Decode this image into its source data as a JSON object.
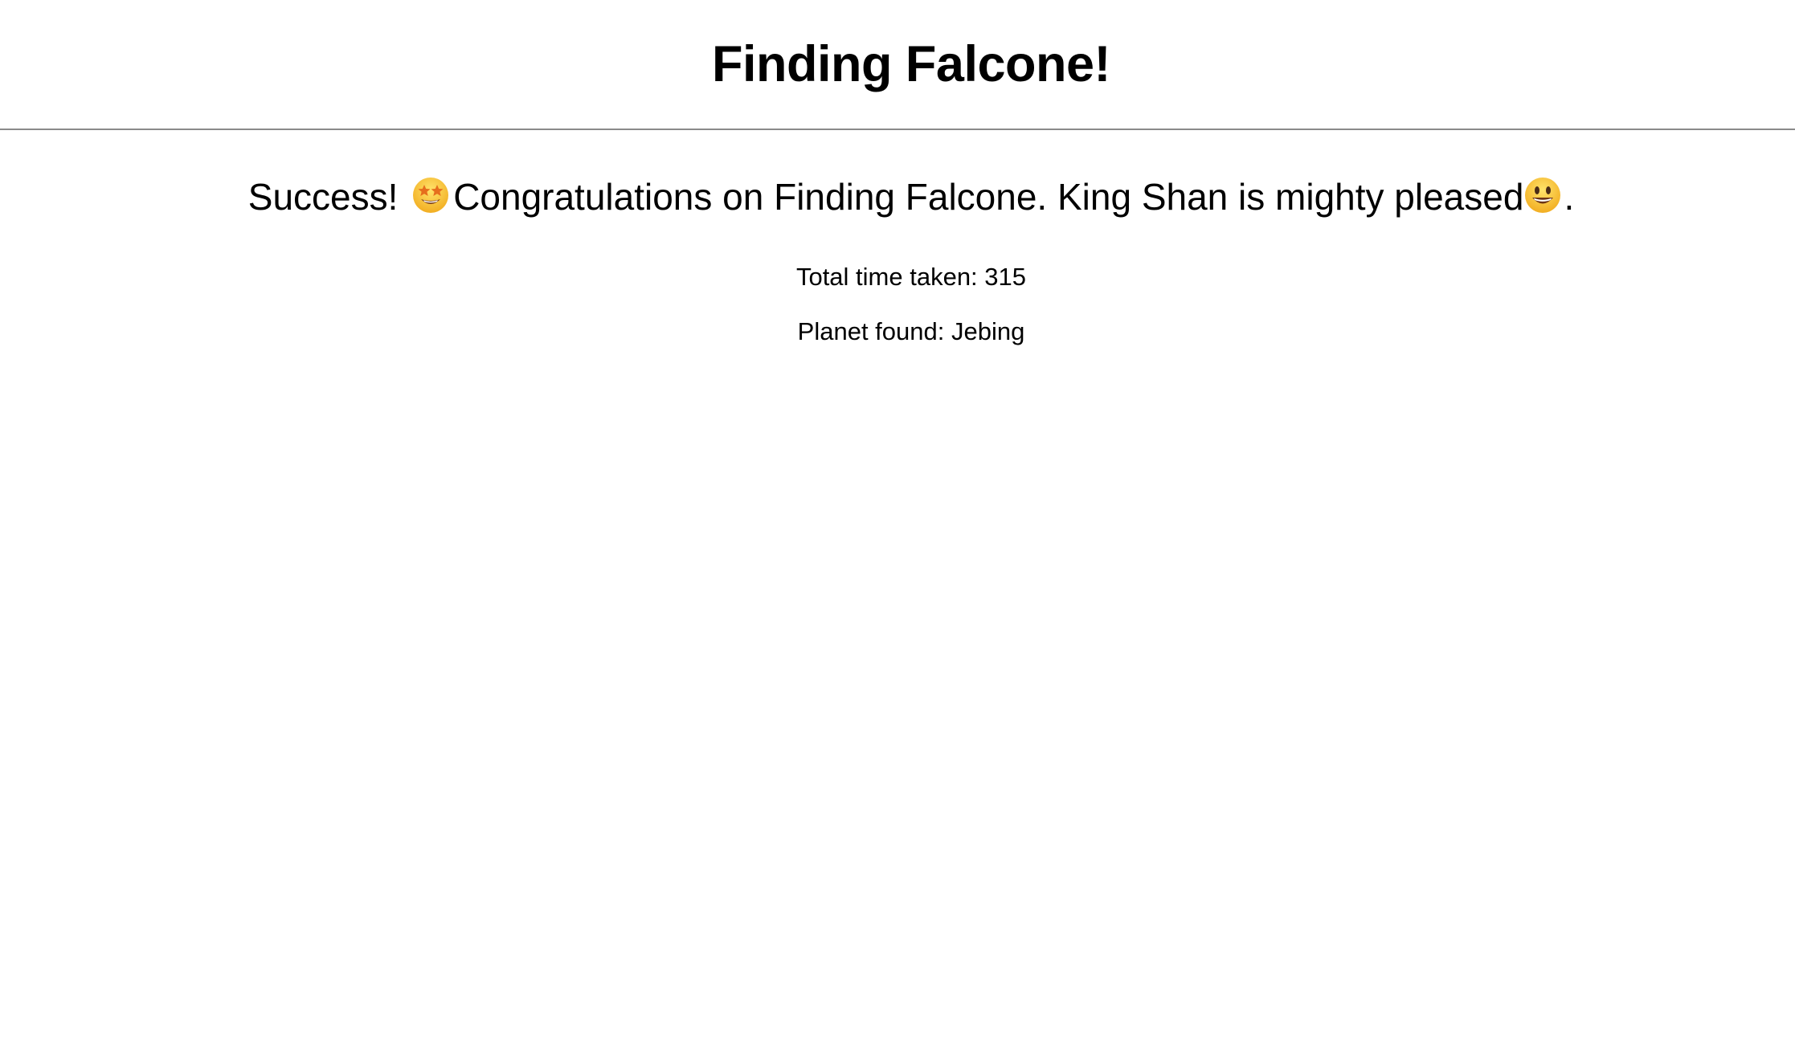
{
  "header": {
    "title": "Finding Falcone!"
  },
  "result": {
    "success_prefix": "Success!",
    "success_icon": "star-struck-emoji-icon",
    "message": "Congratulations on Finding Falcone. King Shan is mighty pleased",
    "message_icon": "grinning-face-emoji-icon",
    "message_suffix": ".",
    "time_label": "Total time taken:",
    "time_value": "315",
    "planet_label": "Planet found:",
    "planet_value": "Jebing"
  },
  "colors": {
    "background": "#ffffff",
    "text": "#000000",
    "divider": "#8a8a8a",
    "emoji_face": "#f7c33c",
    "emoji_star": "#e8751a"
  }
}
